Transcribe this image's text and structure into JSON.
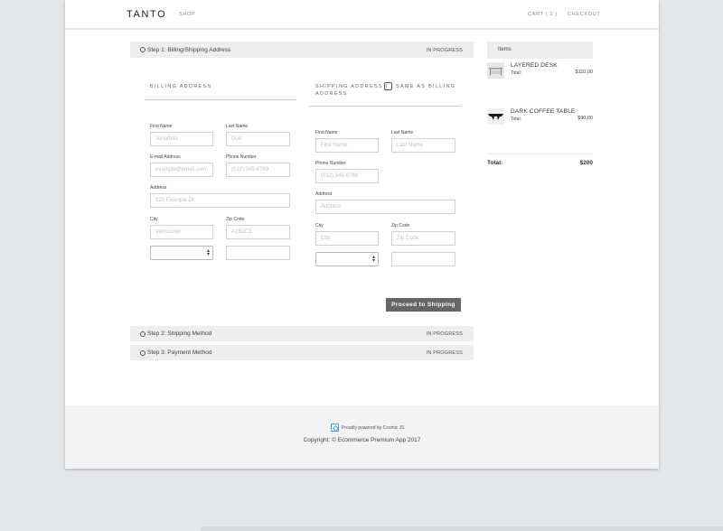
{
  "header": {
    "logo": "TANTO",
    "nav": {
      "shop": "SHOP",
      "cart": "CART ( 2 )",
      "checkout": "CHECKOUT"
    }
  },
  "steps": [
    {
      "title": "Step 1: Billing/Shipping Address",
      "status": "IN PROGRESS"
    },
    {
      "title": "Step 2: Shipping Method",
      "status": "IN PROGRESS"
    },
    {
      "title": "Step 3: Payment Method",
      "status": "IN PROGRESS"
    }
  ],
  "billing": {
    "section_title": "BILLING ADDRESS",
    "first_name": {
      "label": "First Name",
      "placeholder": "Jonathan"
    },
    "last_name": {
      "label": "Last Name",
      "placeholder": "Doe"
    },
    "email": {
      "label": "E-mail Address",
      "placeholder": "example@email.com"
    },
    "phone": {
      "label": "Phone Number",
      "placeholder": "(012) 345-6789"
    },
    "address": {
      "label": "Address",
      "placeholder": "123 Example Dr"
    },
    "city": {
      "label": "City",
      "placeholder": "Vancouver"
    },
    "zip": {
      "label": "Zip Code",
      "placeholder": "A1B2C3"
    }
  },
  "shipping": {
    "section_title_line1": "SHIPPING ADDRESS |",
    "same_as_label": "SAME AS BILLING",
    "section_title_line2": "ADDRESS",
    "first_name": {
      "label": "First Name",
      "placeholder": "First Name"
    },
    "last_name": {
      "label": "Last Name",
      "placeholder": "Last Name"
    },
    "phone": {
      "label": "Phone Number",
      "placeholder": "(012) 345-6789"
    },
    "address": {
      "label": "Address",
      "placeholder": "Address"
    },
    "city": {
      "label": "City",
      "placeholder": "City"
    },
    "zip": {
      "label": "Zip Code",
      "placeholder": "Zip Code"
    }
  },
  "proceed_button": "Proceed to Shipping",
  "cart": {
    "heading": "Items",
    "items": [
      {
        "name": "LAYERED DESK",
        "total_label": "Total:",
        "price": "$110,00"
      },
      {
        "name": "DARK COFFEE TABLE",
        "total_label": "Total:",
        "price": "$90,00"
      }
    ],
    "total_label": "Total:",
    "total_value": "$200"
  },
  "footer": {
    "powered_by": "Proudly powered by Cosmic JS",
    "copyright": "Copyright: © Ecommerce Premium App 2017"
  }
}
